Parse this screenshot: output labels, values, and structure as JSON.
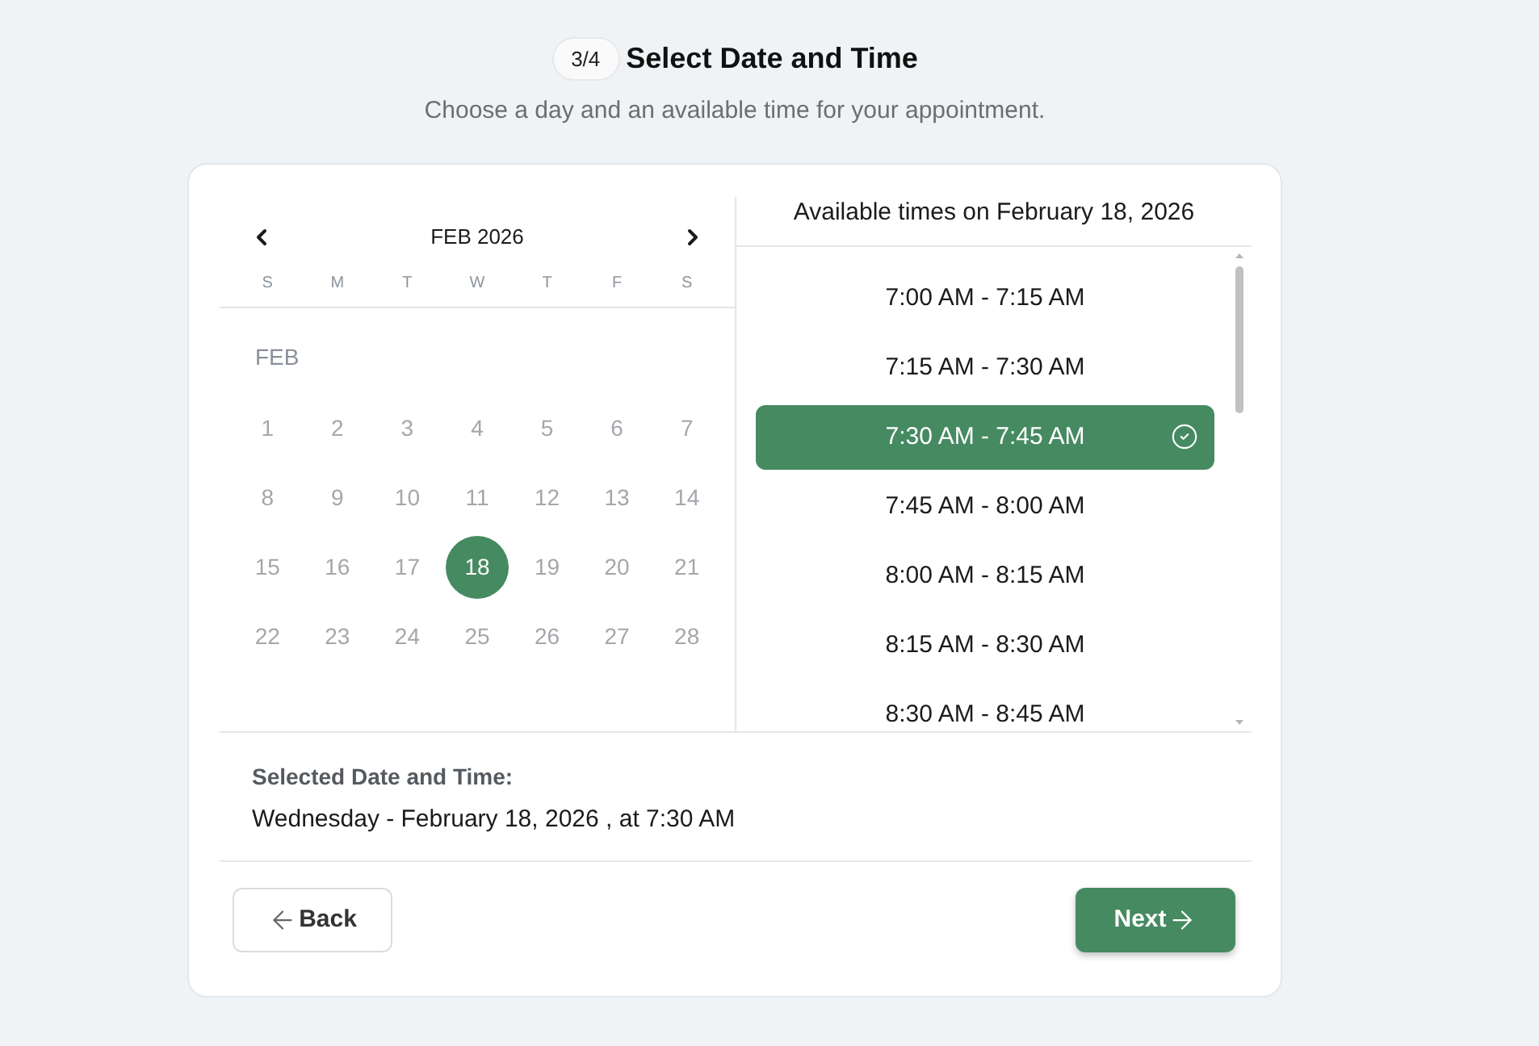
{
  "step": {
    "badge": "3/4",
    "title": "Select Date and Time",
    "subtitle": "Choose a day and an available time for your appointment."
  },
  "calendar": {
    "month_label": "FEB 2026",
    "weekdays": [
      "S",
      "M",
      "T",
      "W",
      "T",
      "F",
      "S"
    ],
    "month_short": "FEB",
    "days": [
      {
        "label": "1",
        "selected": false
      },
      {
        "label": "2",
        "selected": false
      },
      {
        "label": "3",
        "selected": false
      },
      {
        "label": "4",
        "selected": false
      },
      {
        "label": "5",
        "selected": false
      },
      {
        "label": "6",
        "selected": false
      },
      {
        "label": "7",
        "selected": false
      },
      {
        "label": "8",
        "selected": false
      },
      {
        "label": "9",
        "selected": false
      },
      {
        "label": "10",
        "selected": false
      },
      {
        "label": "11",
        "selected": false
      },
      {
        "label": "12",
        "selected": false
      },
      {
        "label": "13",
        "selected": false
      },
      {
        "label": "14",
        "selected": false
      },
      {
        "label": "15",
        "selected": false
      },
      {
        "label": "16",
        "selected": false
      },
      {
        "label": "17",
        "selected": false
      },
      {
        "label": "18",
        "selected": true
      },
      {
        "label": "19",
        "selected": false
      },
      {
        "label": "20",
        "selected": false
      },
      {
        "label": "21",
        "selected": false
      },
      {
        "label": "22",
        "selected": false
      },
      {
        "label": "23",
        "selected": false
      },
      {
        "label": "24",
        "selected": false
      },
      {
        "label": "25",
        "selected": false
      },
      {
        "label": "26",
        "selected": false
      },
      {
        "label": "27",
        "selected": false
      },
      {
        "label": "28",
        "selected": false
      }
    ]
  },
  "times": {
    "header": "Available times on February 18, 2026",
    "slots": [
      {
        "label": "7:00 AM - 7:15 AM",
        "selected": false
      },
      {
        "label": "7:15 AM - 7:30 AM",
        "selected": false
      },
      {
        "label": "7:30 AM - 7:45 AM",
        "selected": true
      },
      {
        "label": "7:45 AM - 8:00 AM",
        "selected": false
      },
      {
        "label": "8:00 AM - 8:15 AM",
        "selected": false
      },
      {
        "label": "8:15 AM - 8:30 AM",
        "selected": false
      },
      {
        "label": "8:30 AM - 8:45 AM",
        "selected": false
      }
    ]
  },
  "summary": {
    "label": "Selected Date and Time:",
    "value": "Wednesday - February 18, 2026 , at 7:30 AM"
  },
  "buttons": {
    "back": "Back",
    "next": "Next"
  }
}
